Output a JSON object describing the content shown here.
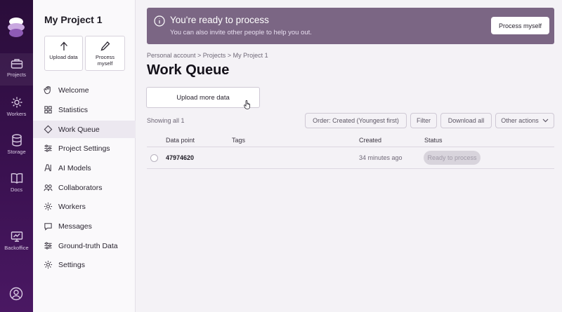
{
  "rail": {
    "items": [
      {
        "label": "Projects",
        "icon": "briefcase-icon"
      },
      {
        "label": "Workers",
        "icon": "gear-icon"
      },
      {
        "label": "Storage",
        "icon": "database-icon"
      },
      {
        "label": "Docs",
        "icon": "book-icon"
      },
      {
        "label": "Backoffice",
        "icon": "monitor-icon"
      }
    ]
  },
  "sidebar": {
    "project_title": "My Project 1",
    "quick_actions": [
      {
        "label": "Upload data",
        "icon": "upload-arrow-icon"
      },
      {
        "label": "Process myself",
        "icon": "pencil-icon"
      }
    ],
    "items": [
      {
        "label": "Welcome",
        "icon": "hand-icon"
      },
      {
        "label": "Statistics",
        "icon": "grid-icon"
      },
      {
        "label": "Work Queue",
        "icon": "diamond-icon",
        "active": true
      },
      {
        "label": "Project Settings",
        "icon": "sliders-icon"
      },
      {
        "label": "AI Models",
        "icon": "ai-icon"
      },
      {
        "label": "Collaborators",
        "icon": "people-icon"
      },
      {
        "label": "Workers",
        "icon": "gear-icon"
      },
      {
        "label": "Messages",
        "icon": "chat-icon"
      },
      {
        "label": "Ground-truth Data",
        "icon": "sliders-icon"
      },
      {
        "label": "Settings",
        "icon": "gear-icon"
      }
    ]
  },
  "banner": {
    "title": "You're ready to process",
    "subtitle": "You can also invite other people to help you out.",
    "button": "Process myself"
  },
  "breadcrumb": "Personal account > Projects > My Project 1",
  "page_title": "Work Queue",
  "upload_more": "Upload more data",
  "toolbar": {
    "showing": "Showing all 1",
    "order": "Order: Created (Youngest first)",
    "filter": "Filter",
    "download": "Download all",
    "other": "Other actions"
  },
  "table": {
    "columns": [
      "Data point",
      "Tags",
      "Created",
      "Status"
    ],
    "rows": [
      {
        "data_point": "47974620",
        "tags": "",
        "created": "34 minutes ago",
        "status": "Ready to process"
      }
    ]
  },
  "colors": {
    "banner": "#7b6684",
    "rail": "#3a1150"
  }
}
